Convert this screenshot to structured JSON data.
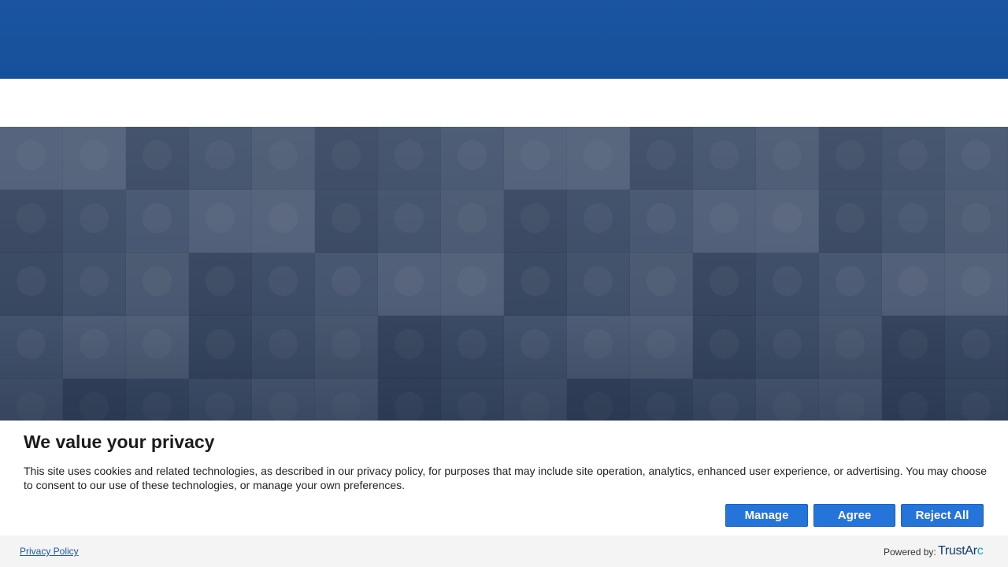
{
  "consent": {
    "title": "We value your privacy",
    "text": "This site uses cookies and related technologies, as described in our privacy policy, for purposes that may include site operation, analytics, enhanced user experience, or advertising. You may choose to consent to our use of these technologies, or manage your own preferences.",
    "buttons": {
      "manage": "Manage",
      "agree": "Agree",
      "reject": "Reject All"
    }
  },
  "footer": {
    "privacy_link": "Privacy Policy",
    "powered_by": "Powered by:",
    "brand_main": "TrustAr",
    "brand_accent": "c"
  },
  "colors": {
    "header_blue": "#1a55a2",
    "button_blue": "#2574d9",
    "link_blue": "#1a56b4"
  }
}
